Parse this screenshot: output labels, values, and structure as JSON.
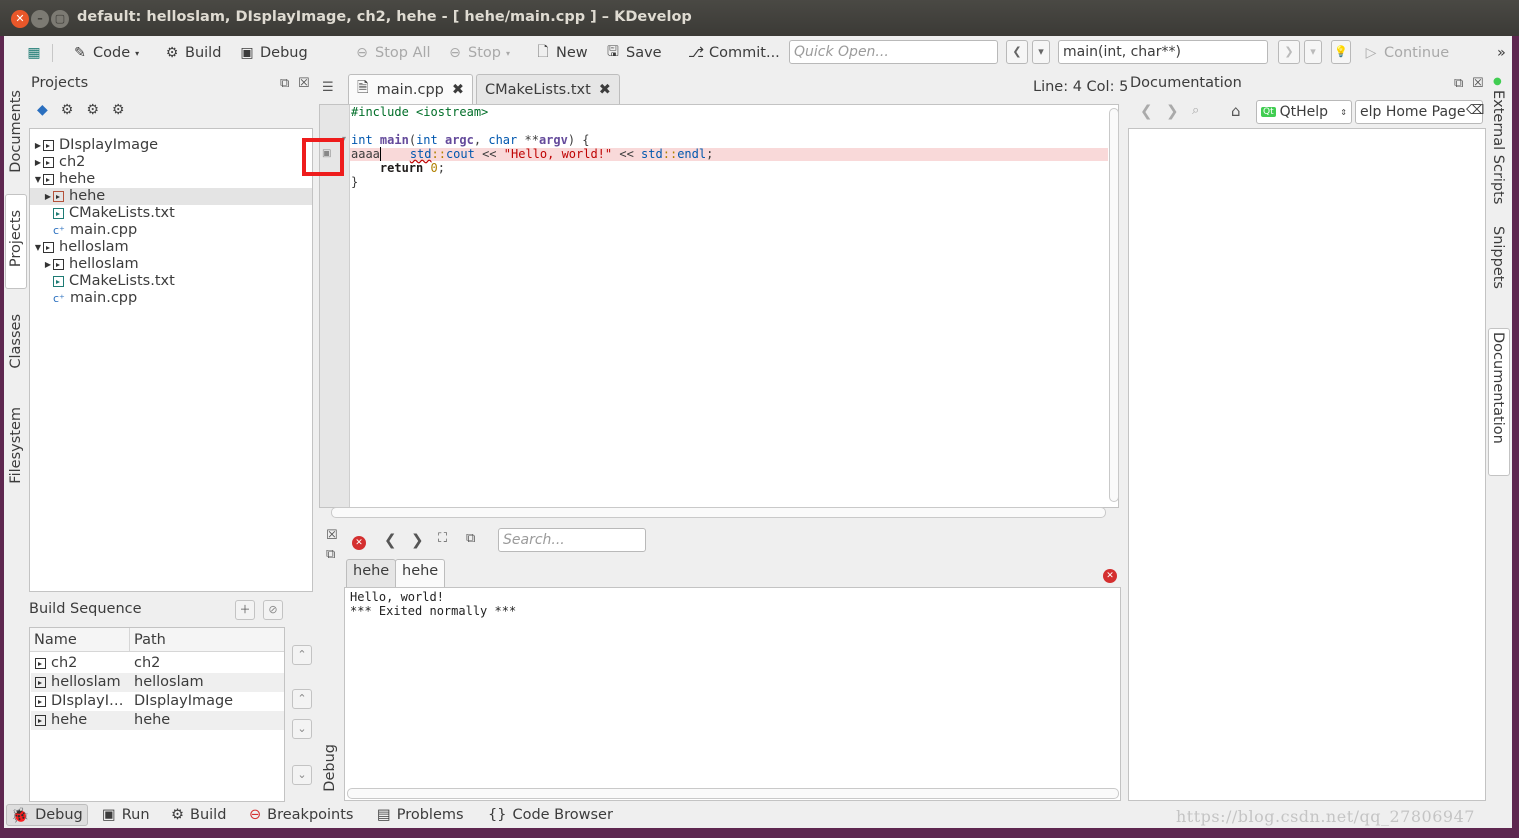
{
  "window": {
    "title": "default:  helloslam, DIsplayImage, ch2, hehe - [ hehe/main.cpp ] – KDevelop"
  },
  "toolbar": {
    "code": "Code",
    "build": "Build",
    "debug": "Debug",
    "stop_all": "Stop All",
    "stop": "Stop",
    "new": "New",
    "save": "Save",
    "commit": "Commit...",
    "quick_open_placeholder": "Quick Open...",
    "context": "main(int, char**)",
    "continue": "Continue",
    "more": "»"
  },
  "projects": {
    "title": "Projects",
    "tree": [
      {
        "label": "DIsplayImage",
        "kind": "folder",
        "indent": 0,
        "arrow": "▶"
      },
      {
        "label": "ch2",
        "kind": "folder",
        "indent": 0,
        "arrow": "▶"
      },
      {
        "label": "hehe",
        "kind": "folder",
        "indent": 0,
        "arrow": "▼"
      },
      {
        "label": "hehe",
        "kind": "target",
        "indent": 1,
        "arrow": "▶",
        "selected": true
      },
      {
        "label": "CMakeLists.txt",
        "kind": "text",
        "indent": 1,
        "arrow": ""
      },
      {
        "label": "main.cpp",
        "kind": "cpp",
        "indent": 1,
        "arrow": ""
      },
      {
        "label": "helloslam",
        "kind": "folder",
        "indent": 0,
        "arrow": "▼"
      },
      {
        "label": "helloslam",
        "kind": "folder",
        "indent": 1,
        "arrow": "▶"
      },
      {
        "label": "CMakeLists.txt",
        "kind": "text",
        "indent": 1,
        "arrow": ""
      },
      {
        "label": "main.cpp",
        "kind": "cpp",
        "indent": 1,
        "arrow": ""
      }
    ]
  },
  "left_tabs": {
    "documents": "Documents",
    "projects": "Projects",
    "classes": "Classes",
    "filesystem": "Filesystem"
  },
  "build_sequence": {
    "title": "Build Sequence",
    "headers": [
      "Name",
      "Path"
    ],
    "rows": [
      {
        "name": "ch2",
        "path": "ch2"
      },
      {
        "name": "helloslam",
        "path": "helloslam"
      },
      {
        "name": "DIsplayI…",
        "path": "DIsplayImage"
      },
      {
        "name": "hehe",
        "path": "hehe"
      }
    ]
  },
  "editor": {
    "tabs": [
      {
        "label": "main.cpp",
        "active": true
      },
      {
        "label": "CMakeLists.txt",
        "active": false
      }
    ],
    "cursor": "Line: 4 Col: 5"
  },
  "output": {
    "search_placeholder": "Search...",
    "tabs": [
      "hehe",
      "hehe"
    ],
    "lines": [
      "Hello, world!",
      "*** Exited normally ***"
    ],
    "side_label": "Debug"
  },
  "documentation": {
    "title": "Documentation",
    "provider": "QtHelp",
    "page": "elp Home Page"
  },
  "right_tabs": {
    "external_scripts": "External Scripts",
    "snippets": "Snippets",
    "documentation": "Documentation"
  },
  "bottom_tabs": {
    "debug": "Debug",
    "run": "Run",
    "build": "Build",
    "breakpoints": "Breakpoints",
    "problems": "Problems",
    "code_browser": "Code Browser"
  },
  "watermark": "https://blog.csdn.net/qq_27806947",
  "colors": {
    "accent_red": "#ee1c1c",
    "error_line": "#f9d9d9",
    "title_bar": "#3b3a36"
  }
}
